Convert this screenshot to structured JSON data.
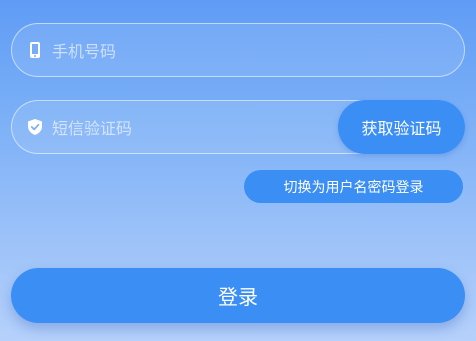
{
  "form": {
    "phone_placeholder": "手机号码",
    "sms_placeholder": "短信验证码",
    "get_code_label": "获取验证码",
    "switch_label": "切换为用户名密码登录",
    "login_label": "登录"
  },
  "icons": {
    "phone": "mobile-phone-icon",
    "sms": "shield-check-icon"
  },
  "colors": {
    "accent": "#3b8ef4",
    "background_top": "#5f9cf5",
    "background_bottom": "#b6d1fb"
  }
}
